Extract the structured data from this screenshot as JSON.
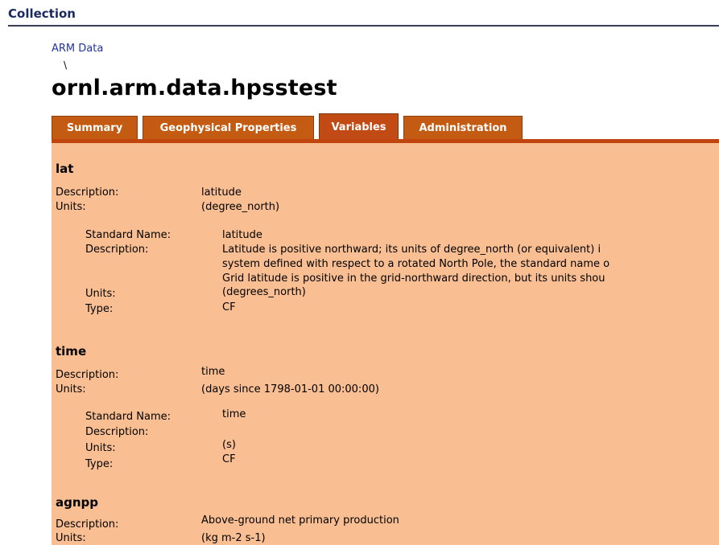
{
  "header": {
    "title": "Collection"
  },
  "breadcrumb": {
    "link": "ARM Data",
    "separator": "\\"
  },
  "page": {
    "title": "ornl.arm.data.hpsstest"
  },
  "tabs": [
    {
      "label": "Summary",
      "active": false
    },
    {
      "label": "Geophysical Properties",
      "active": false
    },
    {
      "label": "Variables",
      "active": true
    },
    {
      "label": "Administration",
      "active": false
    }
  ],
  "labels": {
    "description": "Description:",
    "units": "Units:",
    "standard_name": "Standard Name:",
    "type": "Type:"
  },
  "variables": [
    {
      "name": "lat",
      "description": "latitude",
      "units": "(degree_north)",
      "standard": {
        "name": "latitude",
        "description_lines": [
          "Latitude is positive northward; its units of degree_north (or equivalent) i",
          "system defined with respect to a rotated North Pole, the standard name o",
          "Grid latitude is positive in the grid-northward direction, but its units shou"
        ],
        "units": "(degrees_north)",
        "type": "CF"
      }
    },
    {
      "name": "time",
      "description": "time",
      "units": "(days since 1798-01-01 00:00:00)",
      "standard": {
        "name": "time",
        "description_lines": [],
        "units": "(s)",
        "type": "CF"
      }
    },
    {
      "name": "agnpp",
      "description": "Above-ground net primary production",
      "units": "(kg m-2 s-1)"
    }
  ],
  "colors": {
    "tab": "#c45b12",
    "panel": "#f9be92",
    "header": "#1b2a5e",
    "link": "#23349a"
  }
}
